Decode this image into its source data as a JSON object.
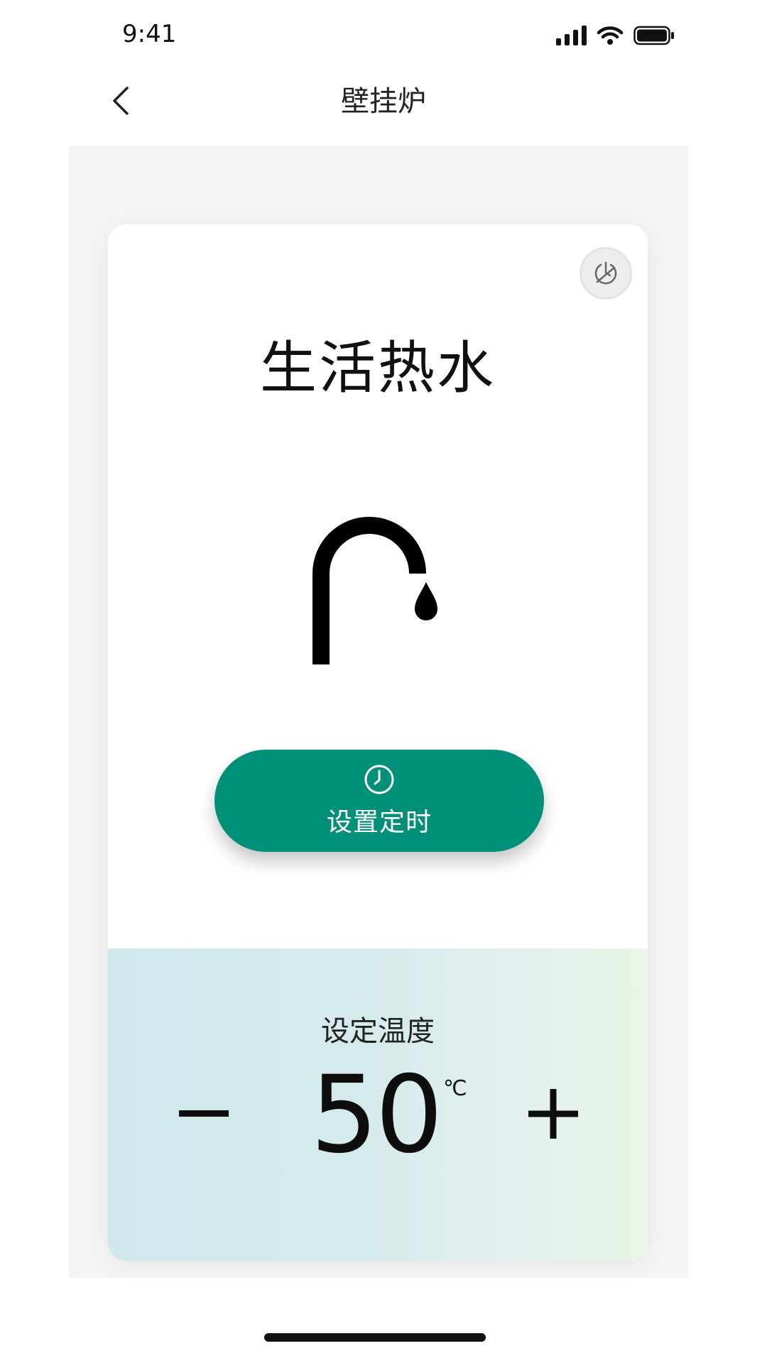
{
  "status_bar": {
    "time": "9:41"
  },
  "nav": {
    "title": "壁挂炉"
  },
  "card": {
    "title": "生活热水",
    "set_timer_label": "设置定时",
    "temperature": {
      "label": "设定温度",
      "value": "50",
      "unit": "℃"
    }
  },
  "icons": {
    "back": "chevron-left-icon",
    "timer_toggle": "timer-power-icon",
    "faucet": "faucet-icon",
    "clock": "clock-icon",
    "minus": "minus-icon",
    "plus": "plus-icon"
  },
  "colors": {
    "accent": "#00907a",
    "panel_bg": "#f4f4f4",
    "temp_bg": "#d5eaec"
  }
}
